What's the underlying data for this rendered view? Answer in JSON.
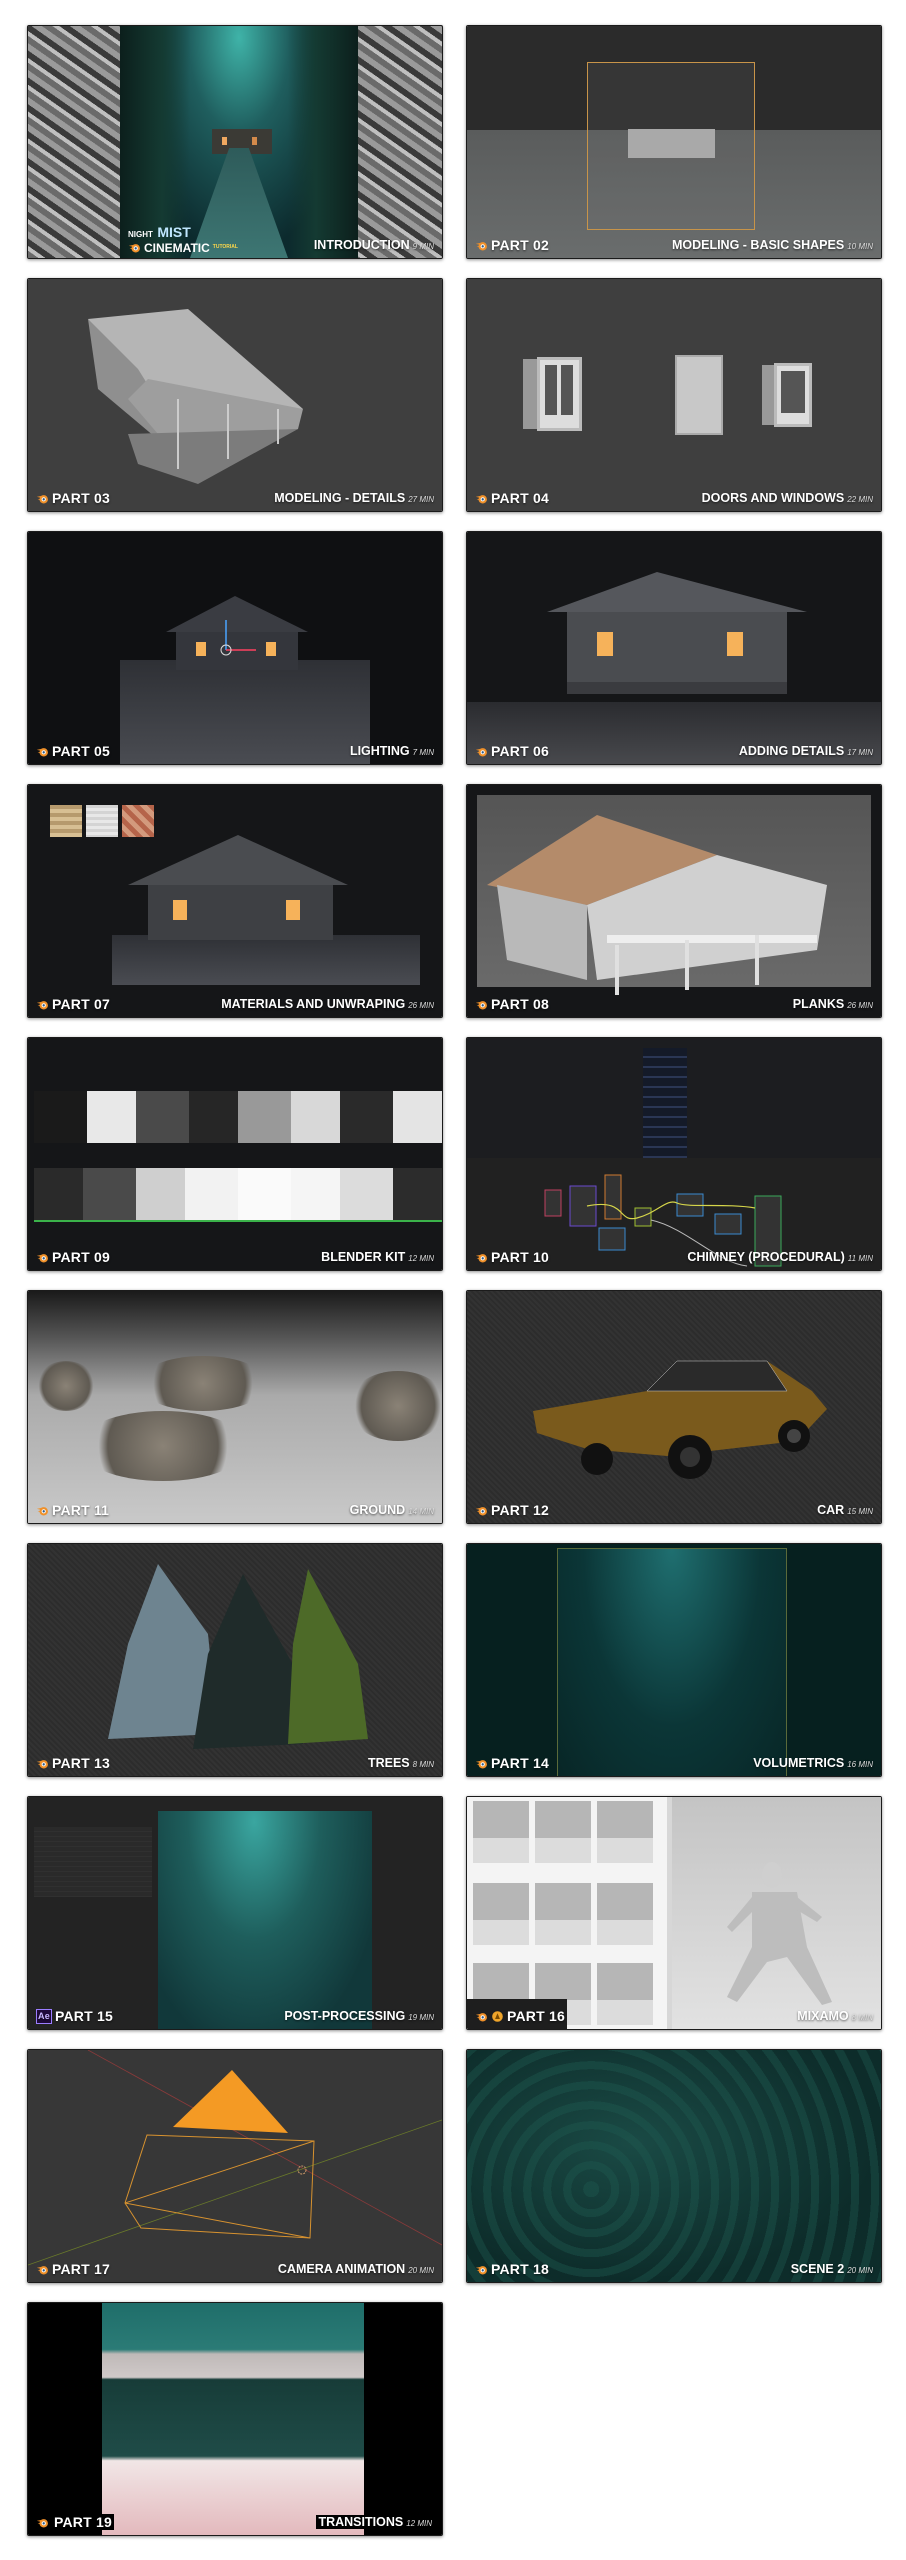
{
  "page": {
    "background": "#ffffff",
    "accent_orange": "#f0912a"
  },
  "intro_brand": {
    "word1": "NIGHT",
    "word2": "MIST",
    "word3": "CINEMATIC",
    "word4": "TUTORIAL"
  },
  "lessons": [
    {
      "part": "",
      "title": "INTRODUCTION",
      "duration": "9 MIN",
      "icon": "blender-icon"
    },
    {
      "part": "PART 02",
      "title": "MODELING - BASIC SHAPES",
      "duration": "10 MIN",
      "icon": "blender-icon"
    },
    {
      "part": "PART 03",
      "title": "MODELING - DETAILS",
      "duration": "27 MIN",
      "icon": "blender-icon"
    },
    {
      "part": "PART 04",
      "title": "DOORS AND WINDOWS",
      "duration": "22 MIN",
      "icon": "blender-icon"
    },
    {
      "part": "PART 05",
      "title": "LIGHTING",
      "duration": "7 MIN",
      "icon": "blender-icon"
    },
    {
      "part": "PART 06",
      "title": "ADDING DETAILS",
      "duration": "17 MIN",
      "icon": "blender-icon"
    },
    {
      "part": "PART 07",
      "title": "MATERIALS AND UNWRAPING",
      "duration": "26 MIN",
      "icon": "blender-icon"
    },
    {
      "part": "PART 08",
      "title": "PLANKS",
      "duration": "26 MIN",
      "icon": "blender-icon"
    },
    {
      "part": "PART 09",
      "title": "BLENDER KIT",
      "duration": "12 MIN",
      "icon": "blender-icon"
    },
    {
      "part": "PART 10",
      "title": "CHIMNEY (PROCEDURAL)",
      "duration": "11 MIN",
      "icon": "blender-icon"
    },
    {
      "part": "PART 11",
      "title": "GROUND",
      "duration": "14 MIN",
      "icon": "blender-icon"
    },
    {
      "part": "PART 12",
      "title": "CAR",
      "duration": "15 MIN",
      "icon": "blender-icon"
    },
    {
      "part": "PART 13",
      "title": "TREES",
      "duration": "8 MIN",
      "icon": "blender-icon"
    },
    {
      "part": "PART 14",
      "title": "VOLUMETRICS",
      "duration": "16 MIN",
      "icon": "blender-icon"
    },
    {
      "part": "PART 15",
      "title": "POST-PROCESSING",
      "duration": "19 MIN",
      "icon": "after-effects-icon",
      "icon_text": "Ae"
    },
    {
      "part": "PART 16",
      "title": "MIXAMO",
      "duration": "8 MIN",
      "icon": "blender-mixamo-icon"
    },
    {
      "part": "PART 17",
      "title": "CAMERA ANIMATION",
      "duration": "20 MIN",
      "icon": "blender-icon"
    },
    {
      "part": "PART 18",
      "title": "SCENE 2",
      "duration": "20 MIN",
      "icon": "blender-icon"
    },
    {
      "part": "PART 19",
      "title": "TRANSITIONS",
      "duration": "12 MIN",
      "icon": "blender-icon"
    }
  ]
}
